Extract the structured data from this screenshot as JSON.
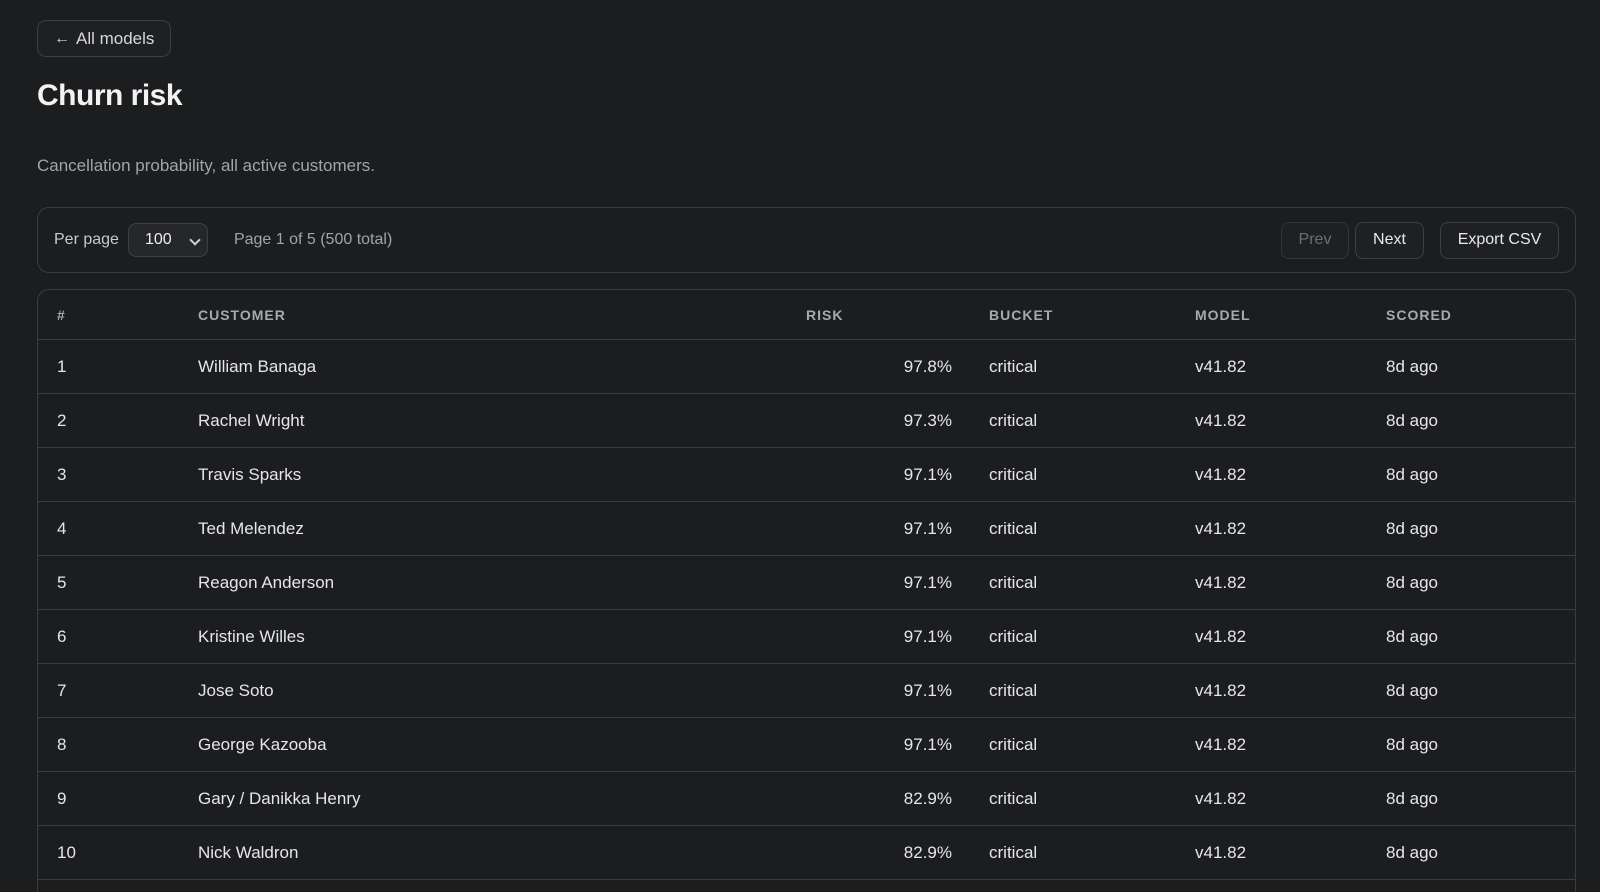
{
  "nav": {
    "back_arrow": "←",
    "back_label": "All models"
  },
  "header": {
    "title": "Churn risk",
    "subtitle": "Cancellation probability, all active customers."
  },
  "toolbar": {
    "per_page_label": "Per page",
    "per_page_value": "100",
    "page_info": "Page 1 of 5 (500 total)",
    "prev_label": "Prev",
    "next_label": "Next",
    "export_label": "Export CSV"
  },
  "table": {
    "columns": [
      "#",
      "CUSTOMER",
      "RISK",
      "BUCKET",
      "MODEL",
      "SCORED"
    ],
    "rows": [
      {
        "num": "1",
        "customer": "William Banaga",
        "risk": "97.8%",
        "bucket": "critical",
        "model": "v41.82",
        "scored": "8d ago"
      },
      {
        "num": "2",
        "customer": "Rachel Wright",
        "risk": "97.3%",
        "bucket": "critical",
        "model": "v41.82",
        "scored": "8d ago"
      },
      {
        "num": "3",
        "customer": "Travis Sparks",
        "risk": "97.1%",
        "bucket": "critical",
        "model": "v41.82",
        "scored": "8d ago"
      },
      {
        "num": "4",
        "customer": "Ted Melendez",
        "risk": "97.1%",
        "bucket": "critical",
        "model": "v41.82",
        "scored": "8d ago"
      },
      {
        "num": "5",
        "customer": "Reagon Anderson",
        "risk": "97.1%",
        "bucket": "critical",
        "model": "v41.82",
        "scored": "8d ago"
      },
      {
        "num": "6",
        "customer": "Kristine Willes",
        "risk": "97.1%",
        "bucket": "critical",
        "model": "v41.82",
        "scored": "8d ago"
      },
      {
        "num": "7",
        "customer": "Jose Soto",
        "risk": "97.1%",
        "bucket": "critical",
        "model": "v41.82",
        "scored": "8d ago"
      },
      {
        "num": "8",
        "customer": "George Kazooba",
        "risk": "97.1%",
        "bucket": "critical",
        "model": "v41.82",
        "scored": "8d ago"
      },
      {
        "num": "9",
        "customer": "Gary / Danikka Henry",
        "risk": "82.9%",
        "bucket": "critical",
        "model": "v41.82",
        "scored": "8d ago"
      },
      {
        "num": "10",
        "customer": "Nick Waldron",
        "risk": "82.9%",
        "bucket": "critical",
        "model": "v41.82",
        "scored": "8d ago"
      }
    ]
  }
}
